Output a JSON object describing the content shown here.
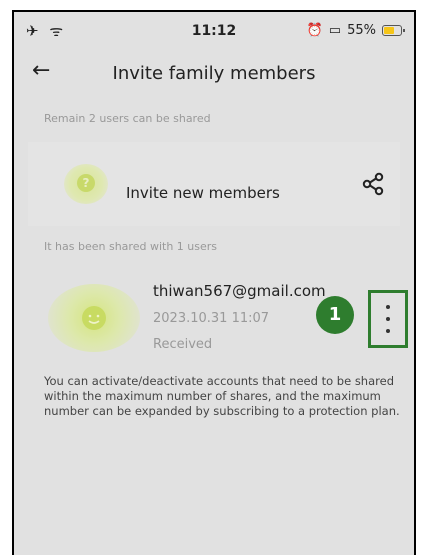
{
  "status_bar": {
    "icons_left": "✈ ᯤ",
    "time": "11:12",
    "battery_percent": "55%"
  },
  "header": {
    "title": "Invite family members"
  },
  "remain_label": "Remain 2 users can be shared",
  "invite": {
    "label": "Invite new members",
    "avatar_glyph": "?"
  },
  "shared_label": "It has been shared with 1 users",
  "member": {
    "email": "thiwan567@gmail.com",
    "date": "2023.10.31 11:07",
    "status": "Received"
  },
  "annotation_badge": "1",
  "info_text": "You can activate/deactivate accounts that need to be shared within the maximum number of shares, and the maximum number can be expanded by subscribing to a protection plan.",
  "colors": {
    "accent_green": "#2e7d2e",
    "avatar_yellow": "#d5e57f",
    "battery": "#f5c518"
  }
}
